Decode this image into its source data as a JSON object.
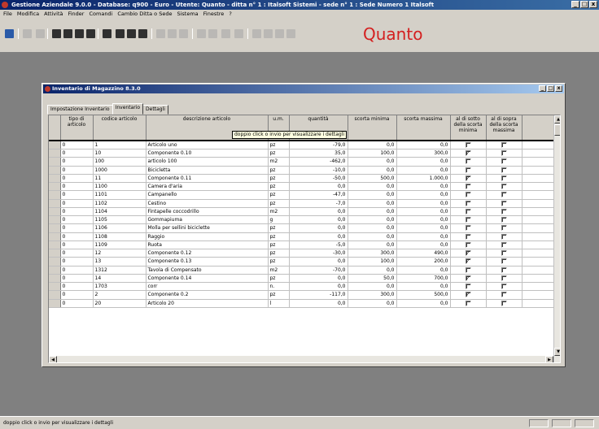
{
  "app": {
    "title": "Gestione Aziendale 9.0.0 - Database: q900 - Euro - Utente: Quanto - ditta n° 1 : Italsoft Sistemi - sede n° 1 : Sede Numero 1 Italsoft",
    "controls": [
      "_",
      "□",
      "x"
    ]
  },
  "menu": [
    "File",
    "Modifica",
    "Attività",
    "Finder",
    "Comandi",
    "Cambio Ditta o Sede",
    "Sistema",
    "Finestre",
    "?"
  ],
  "logo": {
    "text": "Quanto",
    "color": "#d42020"
  },
  "window": {
    "title": "Inventario di Magazzino 8.3.0",
    "tabs": [
      "Impostazione Inventario",
      "Inventario",
      "Dettagli"
    ],
    "active_tab": 1,
    "tooltip": "doppio click o invio per visualizzare i dettagli"
  },
  "table": {
    "columns": [
      "tipo di articolo",
      "codice articolo",
      "descrizione articolo",
      "u.m.",
      "quantità",
      "scorta minima",
      "scorta massima",
      "al di sotto della scorta minima",
      "al di sopra della scorta massima"
    ],
    "rows": [
      [
        "0",
        "1",
        "Articolo uno",
        "pz",
        "-79,0",
        "0,0",
        "0,0",
        false,
        false
      ],
      [
        "0",
        "10",
        "Componente 0.10",
        "pz",
        "35,0",
        "100,0",
        "300,0",
        true,
        false
      ],
      [
        "0",
        "100",
        "articolo 100",
        "m2",
        "-462,0",
        "0,0",
        "0,0",
        false,
        false
      ],
      [
        "0",
        "1000",
        "Bicicletta",
        "pz",
        "-10,0",
        "0,0",
        "0,0",
        false,
        false
      ],
      [
        "0",
        "11",
        "Componente 0.11",
        "pz",
        "-50,0",
        "500,0",
        "1.000,0",
        true,
        false
      ],
      [
        "0",
        "1100",
        "Camera d'aria",
        "pz",
        "0,0",
        "0,0",
        "0,0",
        false,
        false
      ],
      [
        "0",
        "1101",
        "Campanello",
        "pz",
        "-47,0",
        "0,0",
        "0,0",
        false,
        false
      ],
      [
        "0",
        "1102",
        "Cestino",
        "pz",
        "-7,0",
        "0,0",
        "0,0",
        false,
        false
      ],
      [
        "0",
        "1104",
        "Fintapelle coccodrillo",
        "m2",
        "0,0",
        "0,0",
        "0,0",
        false,
        false
      ],
      [
        "0",
        "1105",
        "Gommapiuma",
        "g",
        "0,0",
        "0,0",
        "0,0",
        false,
        false
      ],
      [
        "0",
        "1106",
        "Molla per sellini biciclette",
        "pz",
        "0,0",
        "0,0",
        "0,0",
        false,
        false
      ],
      [
        "0",
        "1108",
        "Raggio",
        "pz",
        "0,0",
        "0,0",
        "0,0",
        false,
        false
      ],
      [
        "0",
        "1109",
        "Ruota",
        "pz",
        "-5,0",
        "0,0",
        "0,0",
        false,
        false
      ],
      [
        "0",
        "12",
        "Componente 0.12",
        "pz",
        "-30,0",
        "300,0",
        "490,0",
        true,
        false
      ],
      [
        "0",
        "13",
        "Componente 0.13",
        "pz",
        "0,0",
        "100,0",
        "200,0",
        true,
        false
      ],
      [
        "0",
        "1312",
        "Tavola di Compensato",
        "m2",
        "-70,0",
        "0,0",
        "0,0",
        false,
        false
      ],
      [
        "0",
        "14",
        "Componente 0.14",
        "pz",
        "0,0",
        "50,0",
        "700,0",
        true,
        false
      ],
      [
        "0",
        "1703",
        "corr",
        "n.",
        "0,0",
        "0,0",
        "0,0",
        false,
        false
      ],
      [
        "0",
        "2",
        "Componente 0.2",
        "pz",
        "-117,0",
        "300,0",
        "500,0",
        true,
        false
      ],
      [
        "0",
        "20",
        "Articolo 20",
        "l",
        "0,0",
        "0,0",
        "0,0",
        false,
        false
      ]
    ]
  },
  "status": {
    "text": "doppio click o invio per visualizzare i dettagli"
  }
}
